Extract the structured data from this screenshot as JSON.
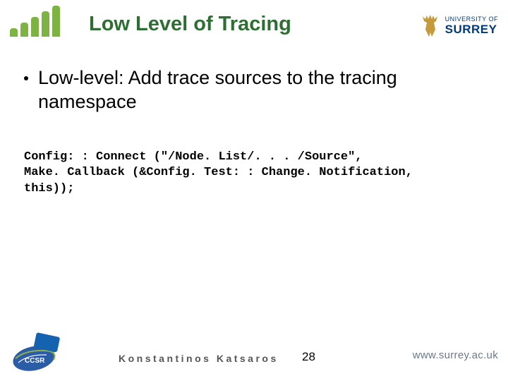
{
  "slide": {
    "title": "Low Level of Tracing",
    "bullet": "Low-level: Add trace sources to the tracing namespace",
    "code": "Config: : Connect (\"/Node. List/. . . /Source\",\nMake. Callback (&Config. Test: : Change. Notification,\nthis));"
  },
  "header": {
    "surrey_small": "UNIVERSITY OF",
    "surrey_big": "SURREY"
  },
  "footer": {
    "author": "Konstantinos Katsaros",
    "page_number": "28",
    "url": "www.surrey.ac.uk",
    "ccsr": "CCSR"
  }
}
